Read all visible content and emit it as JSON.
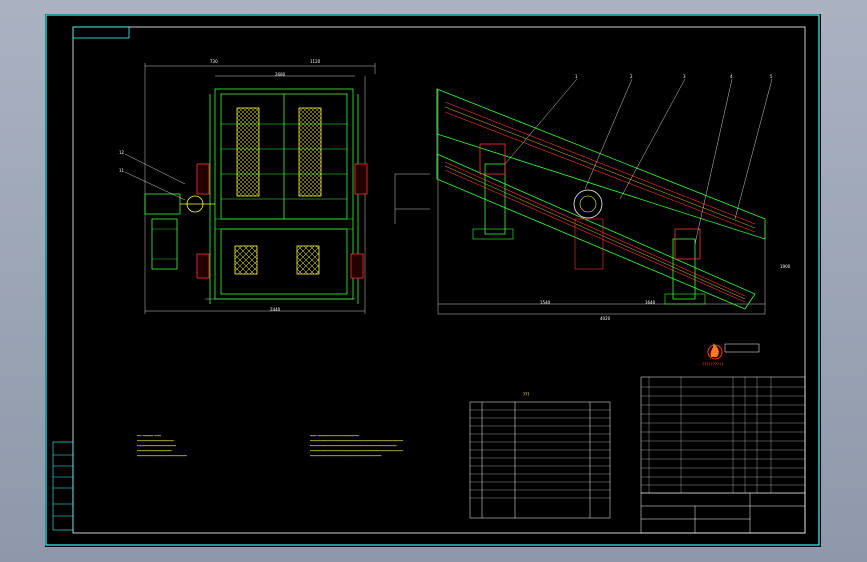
{
  "colors": {
    "background": "#8e98aa",
    "sheet": "#000000",
    "frame": "#33ffff",
    "structure": "#33ff33",
    "lines": "#ffffff",
    "detail": "#ffff33",
    "callout": "#ff3333"
  },
  "icons": {
    "logo": "flame-logo-icon"
  },
  "left_dim_top_a": "730",
  "left_dim_top_b": "1120",
  "left_dim_total": "2680",
  "left_dim_bottom": "2440",
  "right_dim_bottom": "4020",
  "right_dim_mid": "1900",
  "right_dim_left": "1540",
  "right_dim_right": "1640",
  "table_title": "???",
  "logo_text": "??????????",
  "callouts": [
    "1",
    "2",
    "3",
    "4",
    "5"
  ],
  "left_callouts": [
    "12",
    "11"
  ]
}
